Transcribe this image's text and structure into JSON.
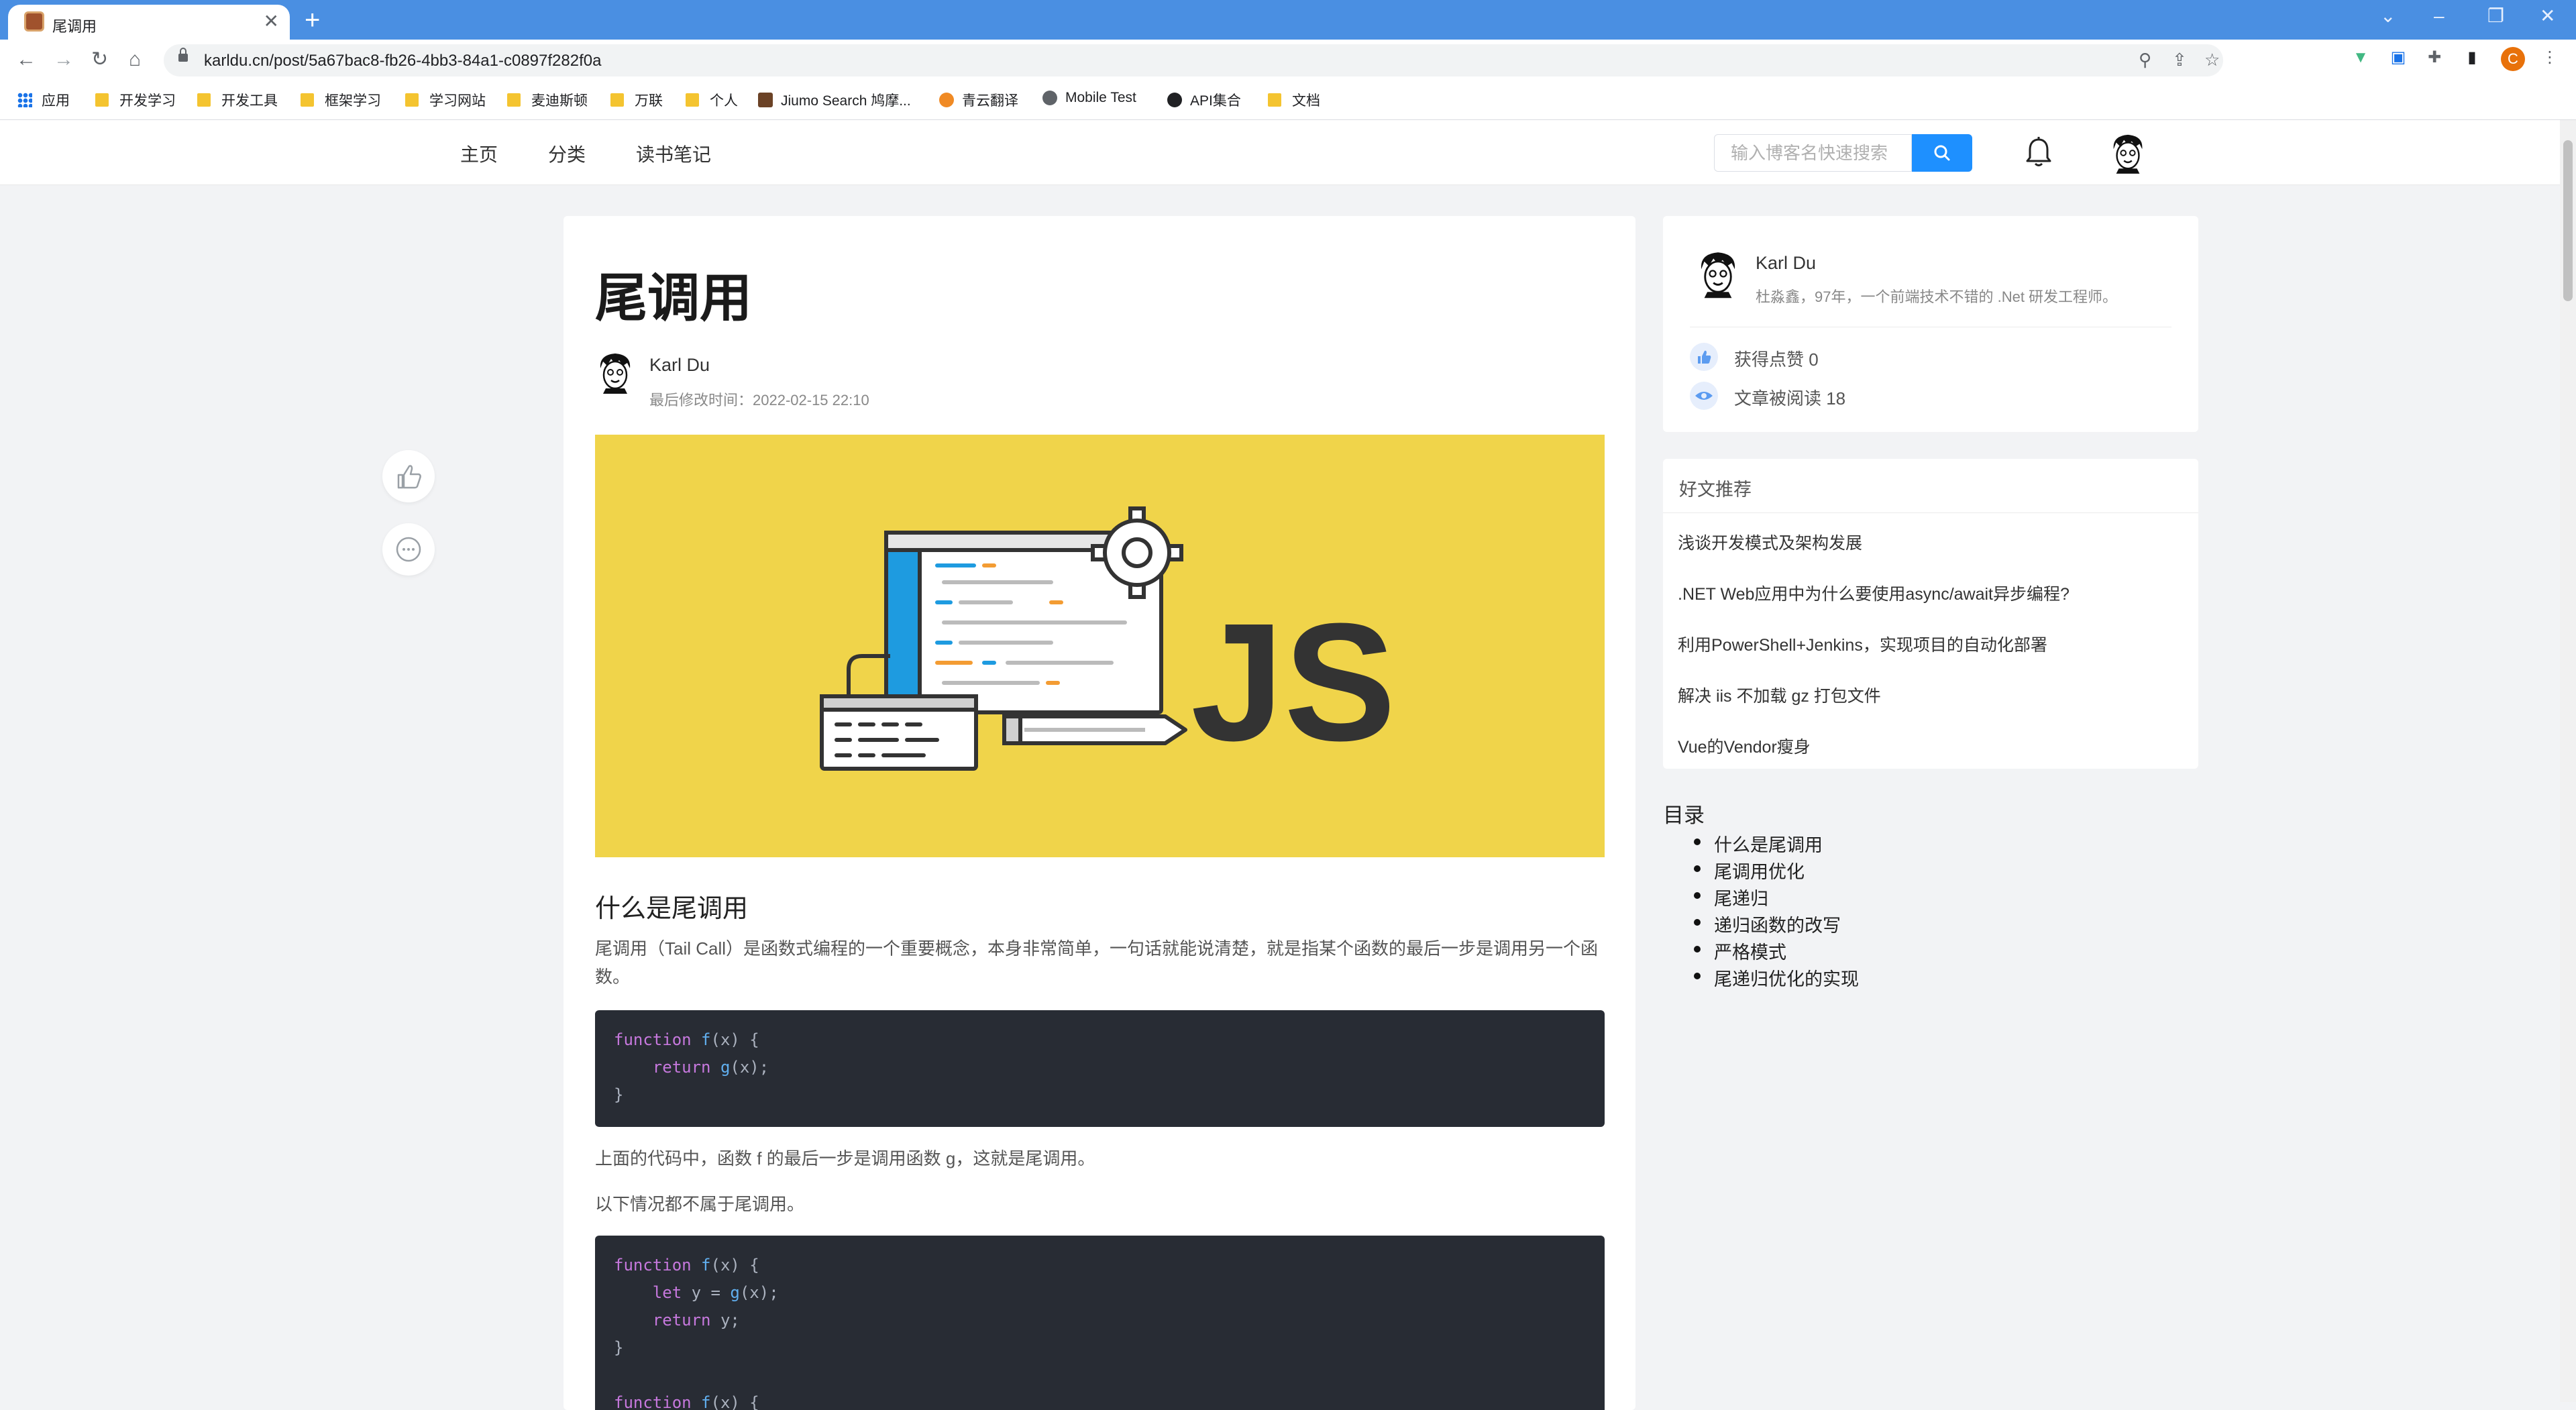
{
  "browser": {
    "tab_title": "尾调用",
    "url": "karldu.cn/post/5a67bac8-fb26-4bb3-84a1-c0897f282f0a",
    "profile_initial": "C",
    "bookmarks": [
      "应用",
      "开发学习",
      "开发工具",
      "框架学习",
      "学习网站",
      "麦迪斯顿",
      "万联",
      "个人",
      "Jiumo Search 鸠摩...",
      "青云翻译",
      "Mobile Test",
      "API集合",
      "文档"
    ]
  },
  "site": {
    "nav": [
      "主页",
      "分类",
      "读书笔记"
    ],
    "search_placeholder": "输入博客名快速搜索"
  },
  "article": {
    "title": "尾调用",
    "author": "Karl Du",
    "modified": "最后修改时间：2022-02-15 22:10",
    "section1_heading": "什么是尾调用",
    "para1": "尾调用（Tail Call）是函数式编程的一个重要概念，本身非常简单，一句话就能说清楚，就是指某个函数的最后一步是调用另一个函数。",
    "code1": [
      "function f(x) {",
      "    return g(x);",
      "}"
    ],
    "para2": "上面的代码中，函数 f 的最后一步是调用函数 g，这就是尾调用。",
    "para3": "以下情况都不属于尾调用。",
    "code2": [
      "function f(x) {",
      "    let y = g(x);",
      "    return y;",
      "}",
      "",
      "function f(x) {"
    ]
  },
  "author_card": {
    "name": "Karl Du",
    "bio": "杜淼鑫，97年，一个前端技术不错的 .Net 研发工程师。",
    "likes": "获得点赞 0",
    "reads": "文章被阅读 18"
  },
  "recommend": {
    "heading": "好文推荐",
    "items": [
      "浅谈开发模式及架构发展",
      ".NET Web应用中为什么要使用async/await异步编程?",
      "利用PowerShell+Jenkins，实现项目的自动化部署",
      "解决 iis 不加载 gz 打包文件",
      "Vue的Vendor瘦身"
    ]
  },
  "toc": {
    "title": "目录",
    "items": [
      "什么是尾调用",
      "尾调用优化",
      "尾递归",
      "递归函数的改写",
      "严格模式",
      "尾递归优化的实现"
    ]
  },
  "colors": {
    "chrome_blue": "#4a8fe2",
    "search_blue": "#1e90ff",
    "cover_yellow": "#f0d44a",
    "code_bg": "#282c34"
  }
}
